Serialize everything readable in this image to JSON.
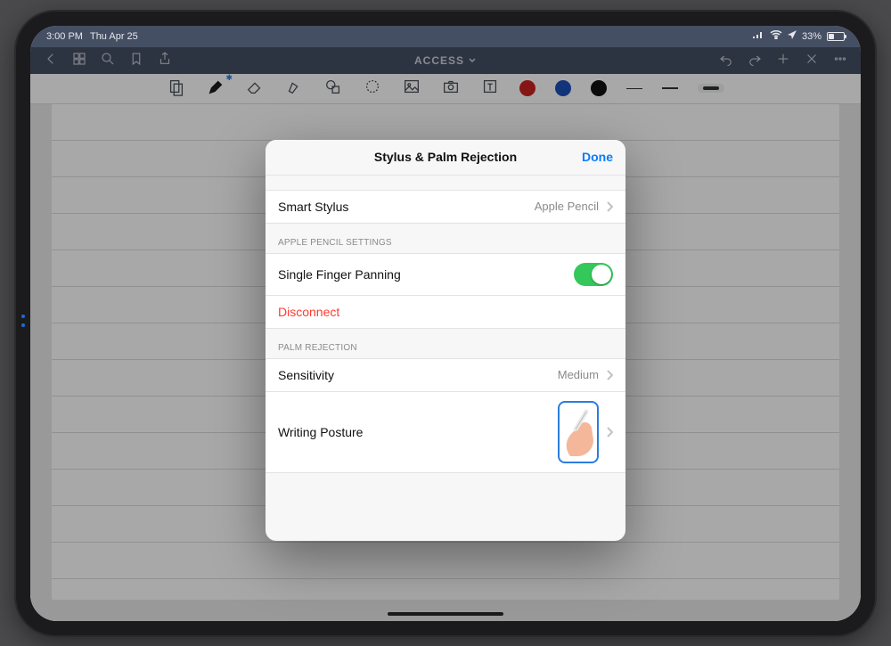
{
  "status": {
    "time": "3:00 PM",
    "date": "Thu Apr 25",
    "battery_pct": "33%"
  },
  "nav": {
    "title": "ACCESS"
  },
  "colors": {
    "red": "#cc2121",
    "blue": "#1e4fbb",
    "black": "#111111"
  },
  "modal": {
    "title": "Stylus & Palm Rejection",
    "done": "Done",
    "smart_stylus_label": "Smart Stylus",
    "smart_stylus_value": "Apple Pencil",
    "section_pencil": "APPLE PENCIL SETTINGS",
    "single_finger_panning": "Single Finger Panning",
    "single_finger_panning_on": true,
    "disconnect": "Disconnect",
    "section_palm": "PALM REJECTION",
    "sensitivity_label": "Sensitivity",
    "sensitivity_value": "Medium",
    "writing_posture_label": "Writing Posture"
  }
}
